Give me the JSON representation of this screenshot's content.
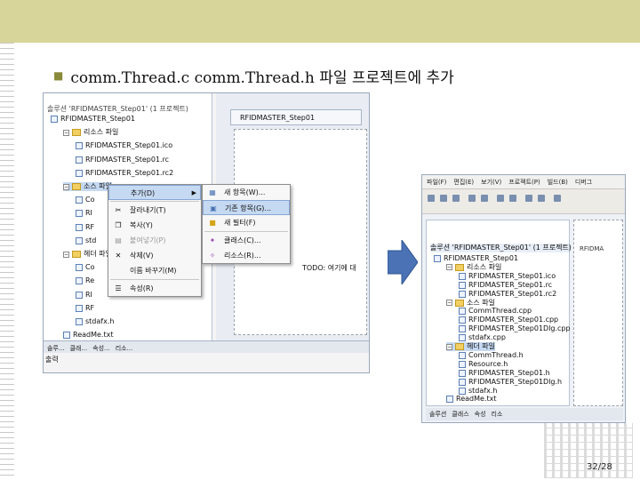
{
  "slide": {
    "bullet_text": "comm.Thread.c  comm.Thread.h  파일 프로젝트에 추가",
    "page_number": "32/28"
  },
  "left_window": {
    "solution_title": "솔루션 'RFIDMASTER_Step01' (1 프로젝트)",
    "tree": [
      {
        "label": "RFIDMASTER_Step01",
        "type": "project",
        "depth": 0
      },
      {
        "label": "리소스 파일",
        "type": "folder",
        "depth": 1
      },
      {
        "label": "RFIDMASTER_Step01.ico",
        "type": "file",
        "depth": 2
      },
      {
        "label": "RFIDMASTER_Step01.rc",
        "type": "file",
        "depth": 2
      },
      {
        "label": "RFIDMASTER_Step01.rc2",
        "type": "file",
        "depth": 2
      },
      {
        "label": "소스 파일",
        "type": "folder",
        "depth": 1,
        "selected": true
      },
      {
        "label": "Co",
        "type": "file",
        "depth": 2
      },
      {
        "label": "RI",
        "type": "file",
        "depth": 2
      },
      {
        "label": "RF",
        "type": "file",
        "depth": 2
      },
      {
        "label": "std",
        "type": "file",
        "depth": 2
      },
      {
        "label": "헤더 파일",
        "type": "folder",
        "depth": 1
      },
      {
        "label": "Co",
        "type": "file",
        "depth": 2
      },
      {
        "label": "Re",
        "type": "file",
        "depth": 2
      },
      {
        "label": "RI",
        "type": "file",
        "depth": 2
      },
      {
        "label": "RF",
        "type": "file",
        "depth": 2
      },
      {
        "label": "stdafx.h",
        "type": "file",
        "depth": 2
      },
      {
        "label": "ReadMe.txt",
        "type": "file",
        "depth": 1
      }
    ],
    "editor_tab": "RFIDMASTER_Step01",
    "todo_text": "TODO: 여기에 대",
    "bottom_tabs": [
      "솔루...",
      "클래...",
      "속성...",
      "리소..."
    ],
    "output_label": "출력"
  },
  "context_menu": {
    "items": [
      {
        "label": "추가(D)",
        "icon": "",
        "highlighted": true,
        "submenu": true
      },
      {
        "label": "잘라내기(T)",
        "icon": "scissors-icon"
      },
      {
        "label": "복사(Y)",
        "icon": "copy-icon"
      },
      {
        "label": "붙여넣기(P)",
        "icon": "paste-icon",
        "disabled": true
      },
      {
        "label": "삭제(V)",
        "icon": "delete-icon"
      },
      {
        "label": "이름 바꾸기(M)",
        "icon": ""
      },
      {
        "label": "속성(R)",
        "icon": "properties-icon"
      }
    ]
  },
  "submenu": {
    "items": [
      {
        "label": "새 항목(W)...",
        "icon": "new-item-icon"
      },
      {
        "label": "기존 항목(G)...",
        "icon": "existing-item-icon",
        "highlighted": true
      },
      {
        "label": "새 필터(F)",
        "icon": "folder-icon"
      },
      {
        "label": "클래스(C)...",
        "icon": "class-icon"
      },
      {
        "label": "리소스(R)...",
        "icon": "resource-icon"
      }
    ]
  },
  "right_window": {
    "menubar": [
      "파일(F)",
      "편집(E)",
      "보기(V)",
      "프로젝트(P)",
      "빌드(B)",
      "디버그"
    ],
    "solution_title": "솔루션 'RFIDMASTER_Step01' (1 프로젝트)",
    "tree": [
      {
        "label": "RFIDMASTER_Step01",
        "type": "project",
        "depth": 0
      },
      {
        "label": "리소스 파일",
        "type": "folder",
        "depth": 1
      },
      {
        "label": "RFIDMASTER_Step01.ico",
        "type": "file",
        "depth": 2
      },
      {
        "label": "RFIDMASTER_Step01.rc",
        "type": "file",
        "depth": 2
      },
      {
        "label": "RFIDMASTER_Step01.rc2",
        "type": "file",
        "depth": 2
      },
      {
        "label": "소스 파일",
        "type": "folder",
        "depth": 1
      },
      {
        "label": "CommThread.cpp",
        "type": "file",
        "depth": 2
      },
      {
        "label": "RFIDMASTER_Step01.cpp",
        "type": "file",
        "depth": 2
      },
      {
        "label": "RFIDMASTER_Step01Dlg.cpp",
        "type": "file",
        "depth": 2
      },
      {
        "label": "stdafx.cpp",
        "type": "file",
        "depth": 2
      },
      {
        "label": "헤더 파일",
        "type": "folder",
        "depth": 1,
        "selected": true
      },
      {
        "label": "CommThread.h",
        "type": "file",
        "depth": 2
      },
      {
        "label": "Resource.h",
        "type": "file",
        "depth": 2
      },
      {
        "label": "RFIDMASTER_Step01.h",
        "type": "file",
        "depth": 2
      },
      {
        "label": "RFIDMASTER_Step01Dlg.h",
        "type": "file",
        "depth": 2
      },
      {
        "label": "stdafx.h",
        "type": "file",
        "depth": 2
      },
      {
        "label": "ReadMe.txt",
        "type": "file",
        "depth": 1
      }
    ],
    "editor_tab": "RFIDMA",
    "bottom_tabs": [
      "솔루션",
      "클래스",
      "속성",
      "리소"
    ]
  },
  "colors": {
    "top_band": "#d8d59a",
    "arrow": "#4a72b5",
    "menu_highlight": "#c5d9f2"
  }
}
